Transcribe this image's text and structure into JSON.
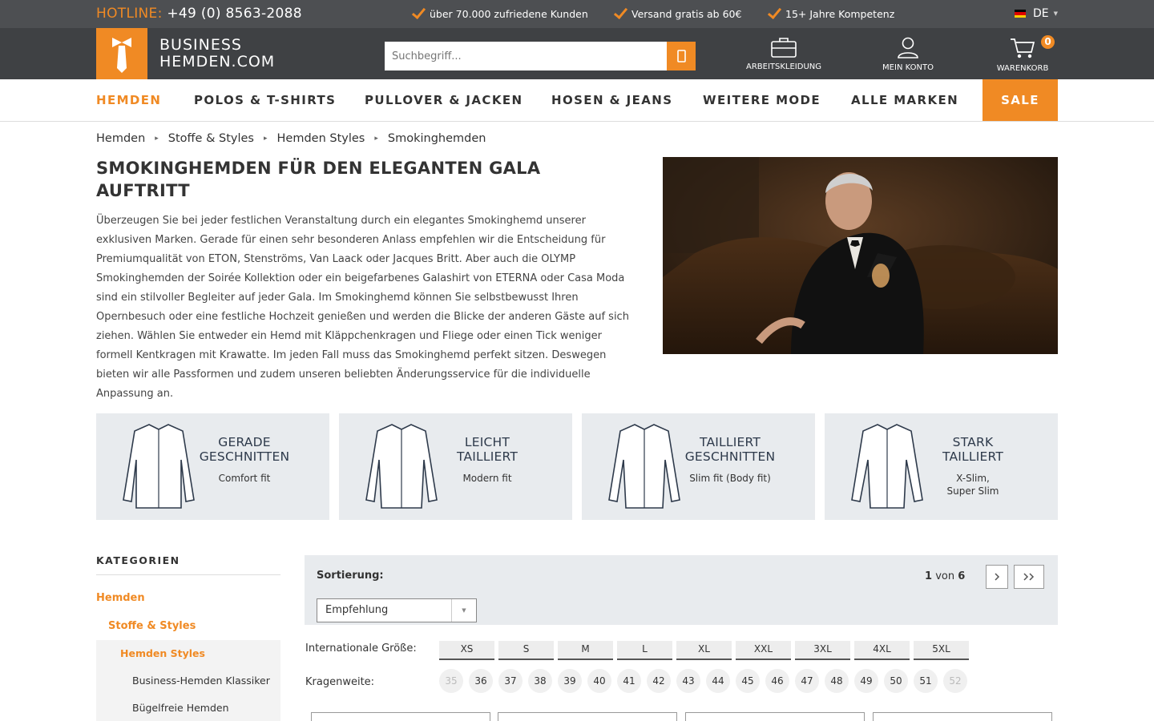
{
  "topbar": {
    "hotline_label": "HOTLINE:",
    "hotline_number": "+49 (0) 8563-2088",
    "usps": [
      "über 70.000 zufriedene Kunden",
      "Versand gratis ab 60€",
      "15+ Jahre Kompetenz"
    ],
    "language": "DE"
  },
  "header": {
    "logo_line1": "BUSINESS",
    "logo_line2": "HEMDEN.COM",
    "search_placeholder": "Suchbegriff...",
    "workwear_label": "ARBEITSKLEIDUNG",
    "account_label": "MEIN KONTO",
    "cart_label": "WARENKORB",
    "cart_count": "0"
  },
  "nav": {
    "items": [
      "HEMDEN",
      "POLOS & T-SHIRTS",
      "PULLOVER & JACKEN",
      "HOSEN & JEANS",
      "WEITERE MODE",
      "ALLE MARKEN"
    ],
    "sale": "SALE"
  },
  "breadcrumb": [
    "Hemden",
    "Stoffe & Styles",
    "Hemden Styles",
    "Smokinghemden"
  ],
  "main": {
    "title": "SMOKINGHEMDEN FÜR DEN ELEGANTEN GALA AUFTRITT",
    "intro": "Überzeugen Sie bei jeder festlichen Veranstaltung durch ein elegantes Smokinghemd unserer exklusiven Marken. Gerade für einen sehr besonderen Anlass empfehlen wir die Entscheidung für Premiumqualität von ETON, Stenströms, Van Laack oder Jacques Britt. Aber auch die OLYMP Smokinghemden der Soirée Kollektion oder ein beigefarbenes Galashirt von ETERNA oder Casa Moda sind ein stilvoller Begleiter auf jeder Gala. Im Smokinghemd können Sie selbstbewusst Ihren Opernbesuch oder eine festliche Hochzeit genießen und werden die Blicke der anderen Gäste auf sich ziehen. Wählen Sie entweder ein Hemd mit Kläppchenkragen und Fliege oder einen Tick weniger formell Kentkragen mit Krawatte. Im jeden Fall muss das Smokinghemd perfekt sitzen. Deswegen bieten wir alle Passformen und zudem unseren beliebten Änderungsservice für die individuelle Anpassung an."
  },
  "fits": [
    {
      "title1": "GERADE",
      "title2": "GESCHNITTEN",
      "sub1": "Comfort fit",
      "sub2": ""
    },
    {
      "title1": "LEICHT",
      "title2": "TAILLIERT",
      "sub1": "Modern fit",
      "sub2": ""
    },
    {
      "title1": "TAILLIERT",
      "title2": "GESCHNITTEN",
      "sub1": "Slim fit (Body fit)",
      "sub2": ""
    },
    {
      "title1": "STARK",
      "title2": "TAILLIERT",
      "sub1": "X-Slim,",
      "sub2": "Super Slim"
    }
  ],
  "sidebar": {
    "heading": "KATEGORIEN",
    "level1": "Hemden",
    "level2": "Stoffe & Styles",
    "level3": "Hemden Styles",
    "children": [
      "Business-Hemden Klassiker",
      "Bügelfreie Hemden"
    ]
  },
  "listing": {
    "sort_label": "Sortierung:",
    "sort_value": "Empfehlung",
    "page_current": "1",
    "page_of": "von",
    "page_total": "6",
    "size_label": "Internationale Größe:",
    "sizes": [
      "XS",
      "S",
      "M",
      "L",
      "XL",
      "XXL",
      "3XL",
      "4XL",
      "5XL"
    ],
    "collar_label": "Kragenweite:",
    "collars": [
      "35",
      "36",
      "37",
      "38",
      "39",
      "40",
      "41",
      "42",
      "43",
      "44",
      "45",
      "46",
      "47",
      "48",
      "49",
      "50",
      "51",
      "52"
    ]
  },
  "colors": {
    "accent": "#f08a24",
    "topbar": "#4d4f52",
    "header": "#3f4144",
    "tile_bg": "#e8ebee"
  }
}
